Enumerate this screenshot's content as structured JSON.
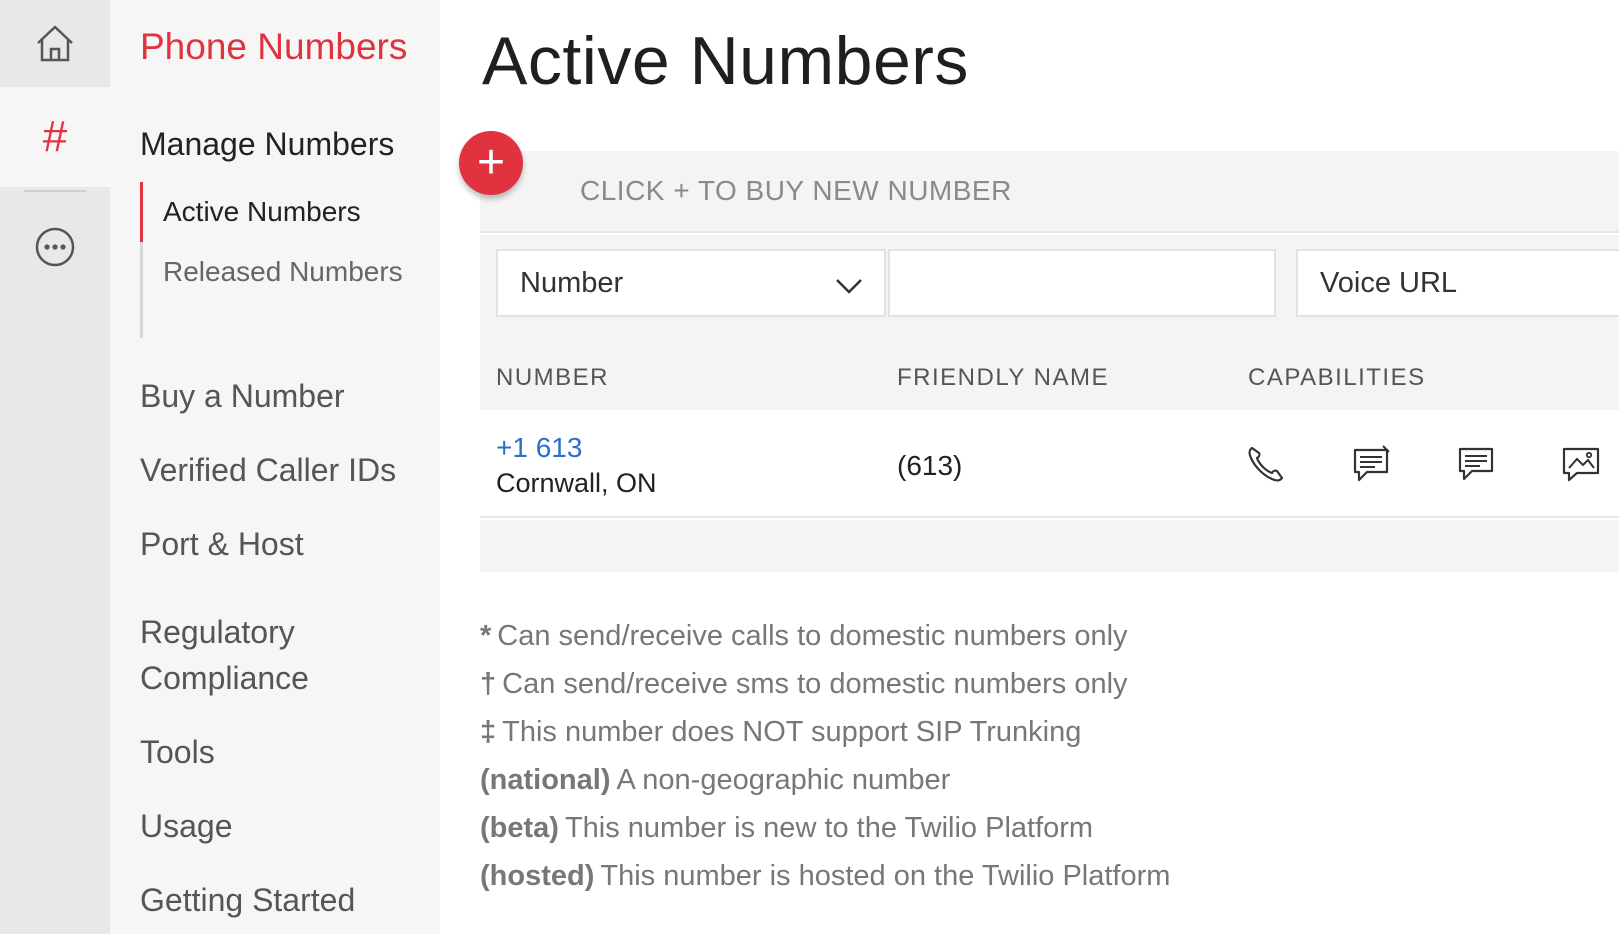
{
  "rail": {
    "items": [
      {
        "icon": "home-icon"
      },
      {
        "icon": "hash-icon",
        "glyph": "#",
        "active": true
      },
      {
        "icon": "more-icon"
      }
    ]
  },
  "sidebar": {
    "title": "Phone Numbers",
    "section": "Manage Numbers",
    "subitems": [
      {
        "label": "Active Numbers",
        "active": true
      },
      {
        "label": "Released Numbers",
        "active": false
      }
    ],
    "links": [
      {
        "label": "Buy a Number"
      },
      {
        "label": "Verified Caller IDs"
      },
      {
        "label": "Port & Host"
      },
      {
        "label": "Regulatory Compliance"
      },
      {
        "label": "Tools"
      },
      {
        "label": "Usage"
      },
      {
        "label": "Getting Started"
      }
    ]
  },
  "main": {
    "title": "Active Numbers",
    "buy_hint": "CLICK + TO BUY NEW NUMBER",
    "add_button": "+",
    "filter": {
      "select_value": "Number",
      "input_value": "",
      "voice_label": "Voice URL"
    },
    "columns": [
      "NUMBER",
      "FRIENDLY NAME",
      "CAPABILITIES"
    ],
    "rows": [
      {
        "number": "+1 613",
        "location": "Cornwall, ON",
        "friendly_name": "(613)",
        "capabilities": [
          "voice-icon",
          "sms-icon",
          "message-icon",
          "mms-icon"
        ]
      }
    ],
    "legend": [
      {
        "mark": "*",
        "text": "Can send/receive calls to domestic numbers only"
      },
      {
        "mark": "†",
        "text": "Can send/receive sms to domestic numbers only"
      },
      {
        "mark": "‡",
        "text": "This number does NOT support SIP Trunking"
      },
      {
        "mark": "(national)",
        "text": "A non-geographic number"
      },
      {
        "mark": "(beta)",
        "text": "This number is new to the Twilio Platform"
      },
      {
        "mark": "(hosted)",
        "text": "This number is hosted on the Twilio Platform"
      }
    ]
  },
  "colors": {
    "accent": "#e0333f",
    "link": "#2a6fcb",
    "panel": "#f4f4f4"
  }
}
